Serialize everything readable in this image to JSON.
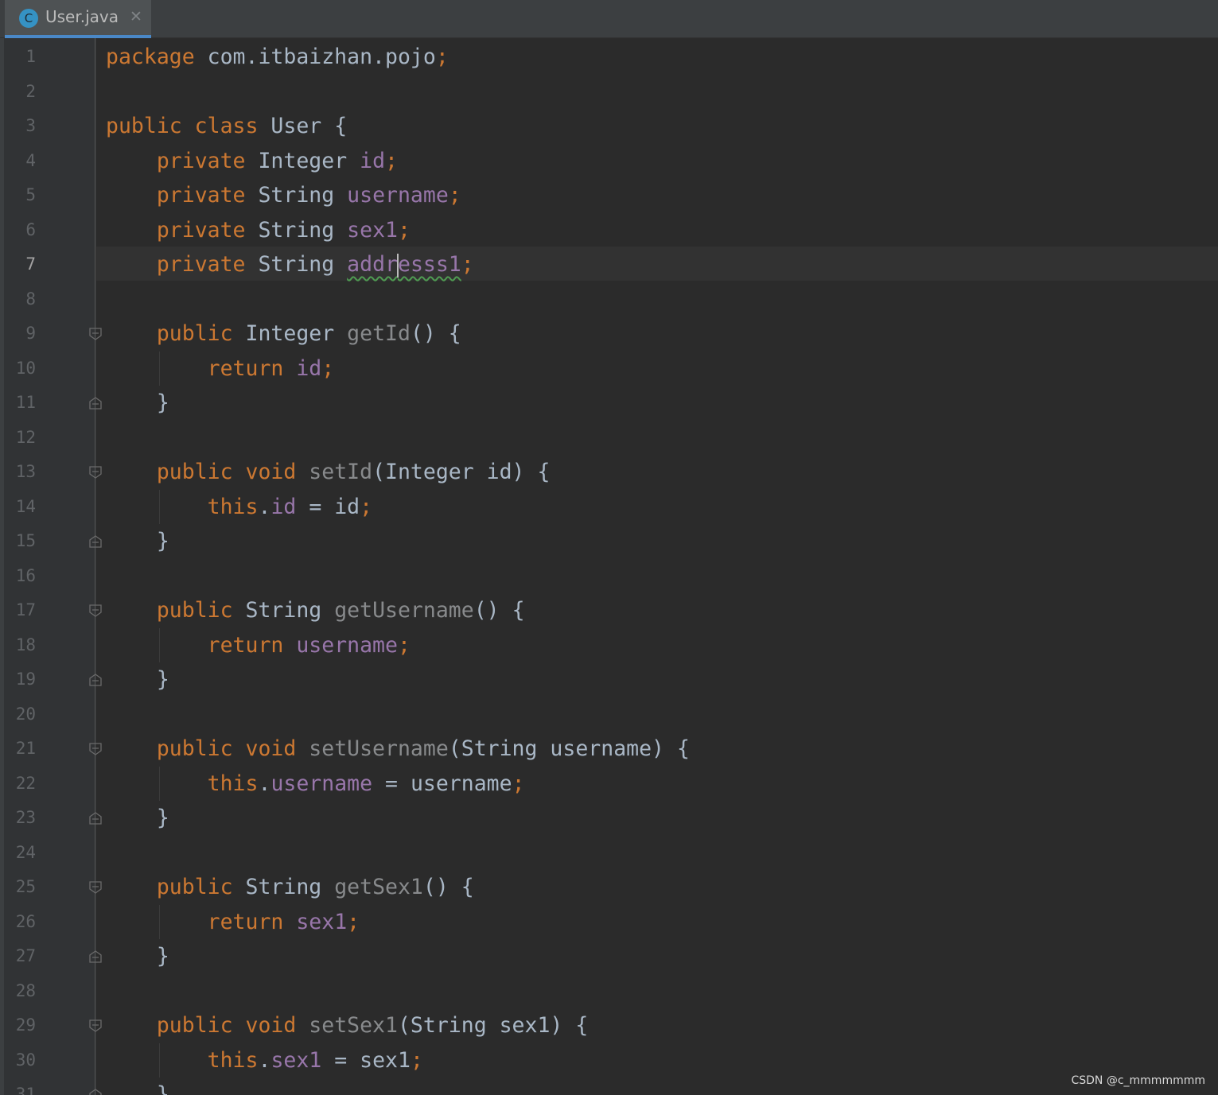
{
  "tab": {
    "icon_letter": "C",
    "title": "User.java",
    "close_glyph": "✕"
  },
  "editor": {
    "current_line": 7,
    "lines": [
      [
        [
          "kw",
          "package "
        ],
        [
          "plain",
          "com.itbaizhan.pojo"
        ],
        [
          "punc",
          ";"
        ]
      ],
      [],
      [
        [
          "kw",
          "public class "
        ],
        [
          "plain",
          "User {"
        ]
      ],
      [
        [
          "plain",
          "    "
        ],
        [
          "kw",
          "private "
        ],
        [
          "plain",
          "Integer "
        ],
        [
          "fld",
          "id"
        ],
        [
          "punc",
          ";"
        ]
      ],
      [
        [
          "plain",
          "    "
        ],
        [
          "kw",
          "private "
        ],
        [
          "plain",
          "String "
        ],
        [
          "fld",
          "username"
        ],
        [
          "punc",
          ";"
        ]
      ],
      [
        [
          "plain",
          "    "
        ],
        [
          "kw",
          "private "
        ],
        [
          "plain",
          "String "
        ],
        [
          "fld",
          "sex1"
        ],
        [
          "punc",
          ";"
        ]
      ],
      [
        [
          "plain",
          "    "
        ],
        [
          "kw",
          "private "
        ],
        [
          "plain",
          "String "
        ],
        [
          "fld-squiggle-a",
          "addr"
        ],
        [
          "caret",
          ""
        ],
        [
          "fld-squiggle-b",
          "esss1"
        ],
        [
          "punc",
          ";"
        ]
      ],
      [],
      [
        [
          "plain",
          "    "
        ],
        [
          "kw",
          "public "
        ],
        [
          "plain",
          "Integer "
        ],
        [
          "mth",
          "getId"
        ],
        [
          "plain",
          "() {"
        ]
      ],
      [
        [
          "plain",
          "        "
        ],
        [
          "kw",
          "return "
        ],
        [
          "fld",
          "id"
        ],
        [
          "punc",
          ";"
        ]
      ],
      [
        [
          "plain",
          "    }"
        ]
      ],
      [],
      [
        [
          "plain",
          "    "
        ],
        [
          "kw",
          "public void "
        ],
        [
          "mth",
          "setId"
        ],
        [
          "plain",
          "(Integer id) {"
        ]
      ],
      [
        [
          "plain",
          "        "
        ],
        [
          "kw",
          "this"
        ],
        [
          "plain",
          "."
        ],
        [
          "fld",
          "id"
        ],
        [
          "plain",
          " = id"
        ],
        [
          "punc",
          ";"
        ]
      ],
      [
        [
          "plain",
          "    }"
        ]
      ],
      [],
      [
        [
          "plain",
          "    "
        ],
        [
          "kw",
          "public "
        ],
        [
          "plain",
          "String "
        ],
        [
          "mth",
          "getUsername"
        ],
        [
          "plain",
          "() {"
        ]
      ],
      [
        [
          "plain",
          "        "
        ],
        [
          "kw",
          "return "
        ],
        [
          "fld",
          "username"
        ],
        [
          "punc",
          ";"
        ]
      ],
      [
        [
          "plain",
          "    }"
        ]
      ],
      [],
      [
        [
          "plain",
          "    "
        ],
        [
          "kw",
          "public void "
        ],
        [
          "mth",
          "setUsername"
        ],
        [
          "plain",
          "(String username) {"
        ]
      ],
      [
        [
          "plain",
          "        "
        ],
        [
          "kw",
          "this"
        ],
        [
          "plain",
          "."
        ],
        [
          "fld",
          "username"
        ],
        [
          "plain",
          " = username"
        ],
        [
          "punc",
          ";"
        ]
      ],
      [
        [
          "plain",
          "    }"
        ]
      ],
      [],
      [
        [
          "plain",
          "    "
        ],
        [
          "kw",
          "public "
        ],
        [
          "plain",
          "String "
        ],
        [
          "mth",
          "getSex1"
        ],
        [
          "plain",
          "() {"
        ]
      ],
      [
        [
          "plain",
          "        "
        ],
        [
          "kw",
          "return "
        ],
        [
          "fld",
          "sex1"
        ],
        [
          "punc",
          ";"
        ]
      ],
      [
        [
          "plain",
          "    }"
        ]
      ],
      [],
      [
        [
          "plain",
          "    "
        ],
        [
          "kw",
          "public void "
        ],
        [
          "mth",
          "setSex1"
        ],
        [
          "plain",
          "(String sex1) {"
        ]
      ],
      [
        [
          "plain",
          "        "
        ],
        [
          "kw",
          "this"
        ],
        [
          "plain",
          "."
        ],
        [
          "fld",
          "sex1"
        ],
        [
          "plain",
          " = sex1"
        ],
        [
          "punc",
          ";"
        ]
      ],
      [
        [
          "plain",
          "    }"
        ]
      ]
    ],
    "fold_open_lines": [
      9,
      13,
      17,
      21,
      25,
      29
    ],
    "fold_close_lines": [
      11,
      15,
      19,
      23,
      27,
      31
    ]
  },
  "colors": {
    "background": "#2b2b2b",
    "keyword": "#cc7832",
    "field": "#9876aa",
    "method_unused": "#888a8c",
    "plain": "#a9b7c6",
    "line_number": "#606366",
    "tab_underline": "#4a88c7"
  },
  "watermark": "CSDN @c_mmmmmmm"
}
